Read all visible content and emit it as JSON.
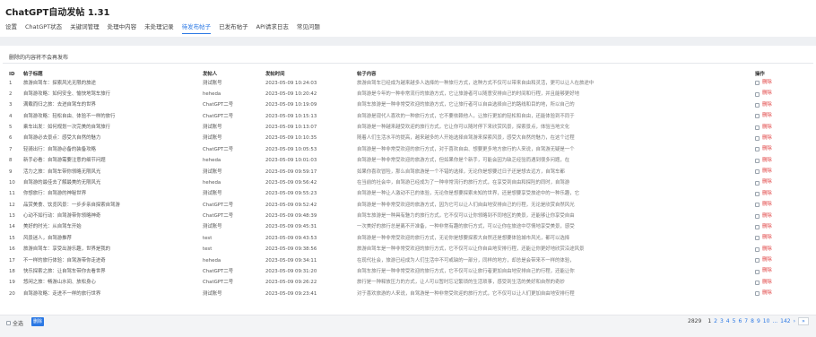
{
  "app": {
    "title": "ChatGPT自动发帖 1.31"
  },
  "tabs": [
    {
      "label": "设置"
    },
    {
      "label": "ChatGPT状态"
    },
    {
      "label": "关键词管理"
    },
    {
      "label": "处理中内容"
    },
    {
      "label": "未处理记录"
    },
    {
      "label": "待发布帖子"
    },
    {
      "label": "已发布帖子"
    },
    {
      "label": "API请求日志"
    },
    {
      "label": "常见问题"
    }
  ],
  "active_tab_index": 5,
  "notice": "删除的内容将不会再发布",
  "table": {
    "headers": {
      "id": "ID",
      "title": "帖子标题",
      "author": "发帖人",
      "time": "发帖时间",
      "content": "帖子内容",
      "ops": "操作"
    },
    "delete_label": "删除",
    "rows": [
      {
        "id": "1",
        "title": "旅游自驾车：探索风光无限的旅途",
        "author": "测试账号",
        "time": "2023-05-09 10:24:03",
        "content": "旅游自驾车已经成为越来越多人选择的一种旅行方式，这种方式不仅可以带来自由和灵活，更可以让人在旅途中"
      },
      {
        "id": "2",
        "title": "自驾游攻略：如何安全、愉快地驾车旅行",
        "author": "heheda",
        "time": "2023-05-09 10:20:42",
        "content": "自驾游是今年的一种非常流行的旅游方式，它让旅游者可以随意安排自己的时间和行程，并且能够更好地"
      },
      {
        "id": "3",
        "title": "满载而归之旅：去进自驾车的世界",
        "author": "ChatGPT二号",
        "time": "2023-05-09 10:19:09",
        "content": "自驾车旅游是一种非常受欢迎的旅游方式，它让旅行者可以自由选择自己的路线和目的地，所以自己的"
      },
      {
        "id": "4",
        "title": "自驾游攻略：轻松自由、体验不一样的旅行",
        "author": "ChatGPT二号",
        "time": "2023-05-09 10:15:13",
        "content": "自驾游是现代人喜欢的一种旅行方式，它不要依赖他人，让旅行更加的轻松和自由，还能体验到不同于"
      },
      {
        "id": "5",
        "title": "乘车出发：如何规划一次完美的自驾旅行",
        "author": "测试账号",
        "time": "2023-05-09 10:13:07",
        "content": "自驾游是一种越来越受欢迎的旅行方式，它让你可以随时停下来欣赏风景，探索景点，体验当地文化"
      },
      {
        "id": "6",
        "title": "自驾游必去景点：感受大自然的魅力",
        "author": "测试账号",
        "time": "2023-05-09 10:10:35",
        "content": "随着人们生活水平的提高，越来越多的人开始选择自驾游来探索风景，感受大自然的魅力，在这个过程"
      },
      {
        "id": "7",
        "title": "轻骑出行：自驾游必备的装备攻略",
        "author": "ChatGPT二号",
        "time": "2023-05-09 10:05:53",
        "content": "自驾游是一种非常受欢迎的旅行方式，对于喜欢自由、想要更多地方旅行的人来说，自驾游无疑是一个"
      },
      {
        "id": "8",
        "title": "新手必看：自驾游需要注意的细节问题",
        "author": "heheda",
        "time": "2023-05-09 10:01:03",
        "content": "自驾游是一种非常受欢迎的旅游方式，但如果你是个新手，可能会因为缺乏经验而遇到很多问题，在"
      },
      {
        "id": "9",
        "title": "活力之旅：自驾车带你领略无限风光",
        "author": "测试账号",
        "time": "2023-05-09 09:59:17",
        "content": "如果你喜欢冒险，那么自驾旅游是一个不错的选择，无论你是想要过日子还是想去远方，自驾车都"
      },
      {
        "id": "10",
        "title": "自驾游的最佳去了解最美的无限风光",
        "author": "heheda",
        "time": "2023-05-09 09:56:42",
        "content": "在当前的社会中，自驾游已经成为了一种非常流行的旅行方式，在享受到自由和探险的同时，自驾游"
      },
      {
        "id": "11",
        "title": "你想旅行：自驾游的神秘世界",
        "author": "测试账号",
        "time": "2023-05-09 09:55:23",
        "content": "自驾游是一种让人激动不已的体验，无论你是想要探索未知的世界，还是想要享受旅途中的一种乐趣，它"
      },
      {
        "id": "12",
        "title": "品赏美食、饮览风景：一步步亲自探索自驾游",
        "author": "ChatGPT二号",
        "time": "2023-05-09 09:52:42",
        "content": "自驾游是一种非常受欢迎的旅游方式，因为它可以让人们自由地安排自己的行程，无论是欣赏自然风光"
      },
      {
        "id": "13",
        "title": "心动不如行动：自驾游带你领略神奇",
        "author": "ChatGPT二号",
        "time": "2023-05-09 09:48:39",
        "content": "自驾车旅游是一种具有魅力的旅行方式，它不仅可以让你领略到不同地区的美景，还能够让你享受自由"
      },
      {
        "id": "14",
        "title": "美好的时光：从自驾车开始",
        "author": "测试账号",
        "time": "2023-05-09 09:45:31",
        "content": "一次美好的旅行总是离不开准备，一种非常有趣的旅行方式，可以让你在旅途中尽情地享受美景，感受"
      },
      {
        "id": "15",
        "title": "风景迷人，自驾游推荐",
        "author": "test",
        "time": "2023-05-09 09:43:53",
        "content": "自驾游是一种非常受欢迎的旅行方式，无论你是想要探索大自然还是想要体验城市风光，都可以选择"
      },
      {
        "id": "16",
        "title": "旅游自驾车：享受出游乐趣，世界是我的",
        "author": "test",
        "time": "2023-05-09 09:38:56",
        "content": "旅游自驾车是一种非常受欢迎的旅行方式，它不仅可以让你自由地安排行程，还能让你更好地欣赏沿途风景"
      },
      {
        "id": "17",
        "title": "不一样的旅行体验：自驾游带你走进奇",
        "author": "heheda",
        "time": "2023-05-09 09:34:11",
        "content": "在现代社会，旅游已经成为人们生活中不可或缺的一部分，同样的地方，却总是会带来不一样的体验，"
      },
      {
        "id": "18",
        "title": "快乐探索之旅：让自驾车带你去看世界",
        "author": "ChatGPT二号",
        "time": "2023-05-09 09:31:20",
        "content": "自驾车旅行是一种非常受欢迎的旅行方式，它不仅可以让旅行者更加自由地安排自己的行程，还能让你"
      },
      {
        "id": "19",
        "title": "悠闲之旅：畅游山水间、放松身心",
        "author": "ChatGPT二号",
        "time": "2023-05-09 09:26:22",
        "content": "旅行是一种释放压力的方式，让人可以暂时忘记繁琐的生活琐事，感受到生活的美好和自然的奇妙"
      },
      {
        "id": "20",
        "title": "自驾游攻略：走进不一样的旅行世界",
        "author": "测试账号",
        "time": "2023-05-09 09:23:41",
        "content": "对于喜欢旅游的人来说，自驾游是一种非常受欢迎的旅行方式，它不仅可以让人们更加自由地安排行程"
      }
    ]
  },
  "footer": {
    "select_all": "全选",
    "delete_button": "删除",
    "total": "2829",
    "pages": [
      "1",
      "2",
      "3",
      "4",
      "5",
      "6",
      "7",
      "8",
      "9",
      "10",
      "...",
      "142"
    ],
    "current_page": "1",
    "next": "›",
    "next_all": "»"
  },
  "colors": {
    "accent": "#2b78e4",
    "delete": "#e03e3e",
    "band": "#eef0f3"
  }
}
